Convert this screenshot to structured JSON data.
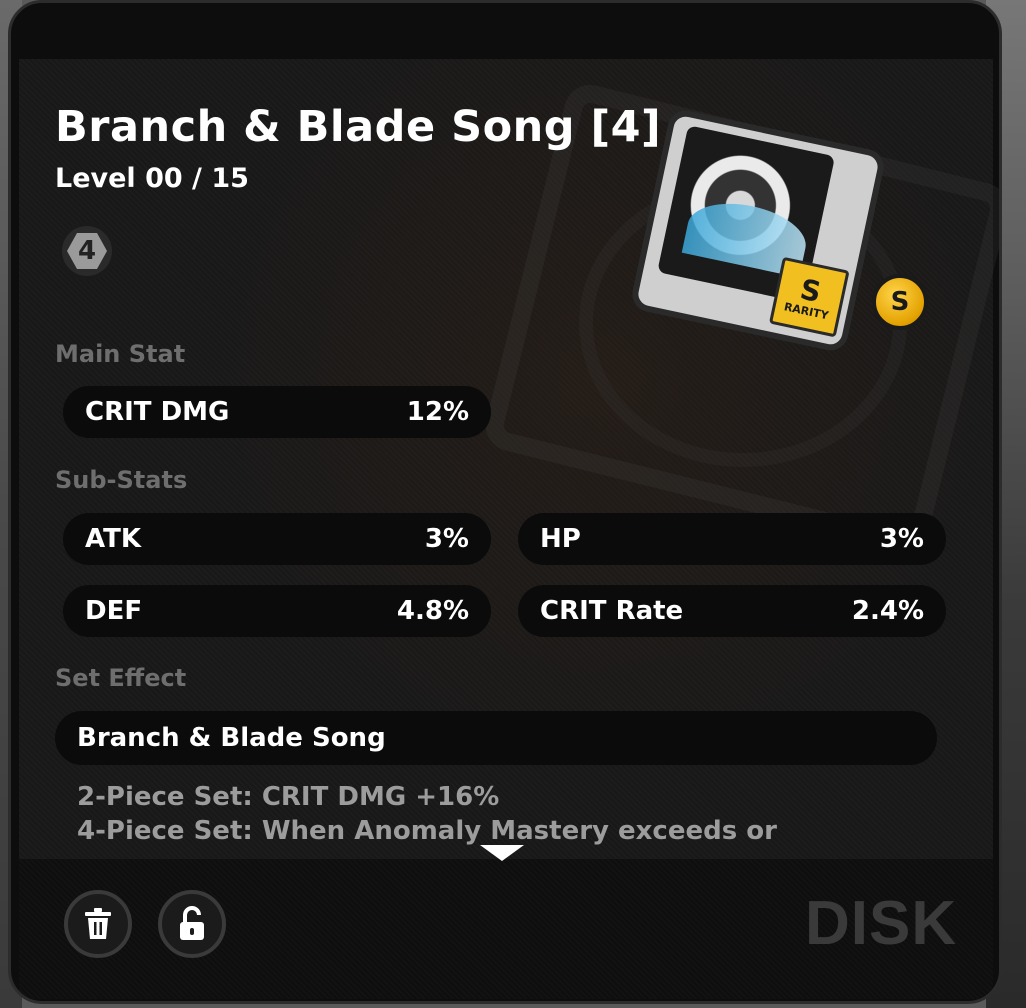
{
  "disc": {
    "title": "Branch & Blade Song [4]",
    "level": "Level 00 / 15",
    "slot_number": "4",
    "rank": "S",
    "rarity_label": "RARITY",
    "rarity_letter": "S"
  },
  "main_stat": {
    "label": "Main Stat",
    "name": "CRIT DMG",
    "value": "12%"
  },
  "sub_stats": {
    "label": "Sub-Stats",
    "items": [
      {
        "name": "ATK",
        "value": "3%"
      },
      {
        "name": "HP",
        "value": "3%"
      },
      {
        "name": "DEF",
        "value": "4.8%"
      },
      {
        "name": "CRIT Rate",
        "value": "2.4%"
      }
    ]
  },
  "set_effect": {
    "label": "Set Effect",
    "name": "Branch & Blade Song",
    "line1": "2-Piece Set: CRIT DMG +16%",
    "line2": "4-Piece Set: When Anomaly Mastery exceeds or"
  },
  "footer": {
    "watermark": "DISK"
  },
  "icons": {
    "delete": "trash-icon",
    "lock": "unlock-icon",
    "scroll": "chevron-down-icon"
  },
  "colors": {
    "panel_bg": "#0d0d0d",
    "stat_row_bg": "#0b0b0b",
    "section_label": "#6e6e6e",
    "rank_gold": "#f1bf1f"
  }
}
